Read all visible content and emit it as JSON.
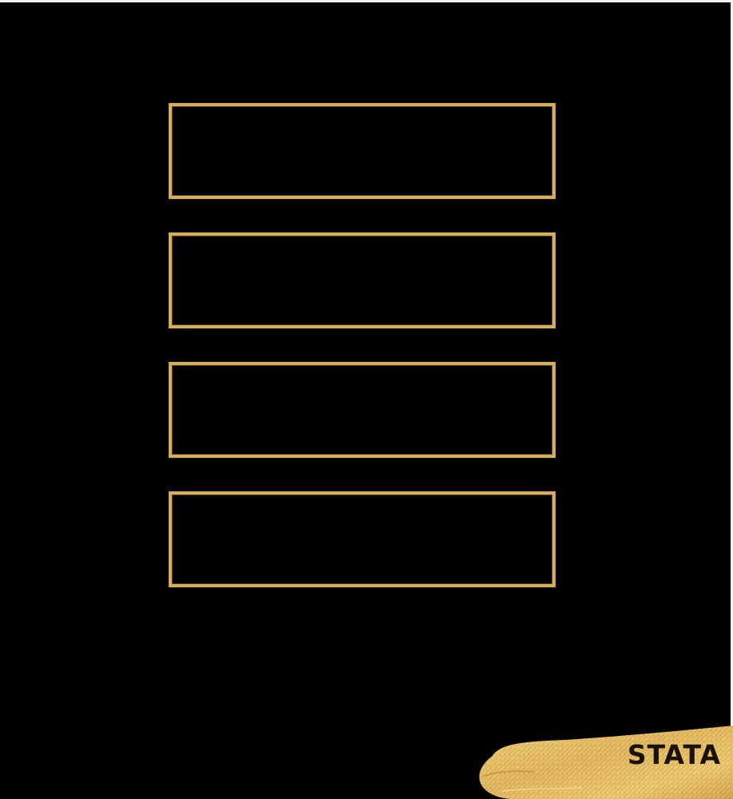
{
  "colors": {
    "background": "#000000",
    "frame_gold": "#d8ad58",
    "brush_gold_light": "#f2d27c",
    "brush_gold_dark": "#b98a32",
    "brand_text": "#1b1206"
  },
  "frames": [
    {
      "text": ""
    },
    {
      "text": ""
    },
    {
      "text": ""
    },
    {
      "text": ""
    }
  ],
  "brand": {
    "label": "STATA"
  }
}
